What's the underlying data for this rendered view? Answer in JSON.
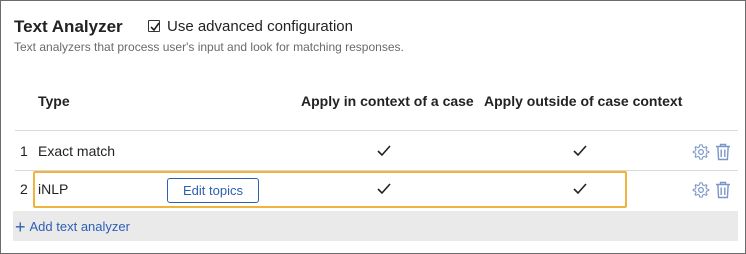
{
  "header": {
    "title": "Text Analyzer",
    "advanced_config_label": "Use advanced configuration",
    "advanced_config_checked": true,
    "subtitle": "Text analyzers that process user's input and look for matching responses."
  },
  "table": {
    "columns": [
      "Type",
      "Apply in context of a case",
      "Apply outside of case context"
    ],
    "rows": [
      {
        "index": "1",
        "type": "Exact match",
        "apply_in_case": true,
        "apply_outside_case": true
      },
      {
        "index": "2",
        "type": "iNLP",
        "apply_in_case": true,
        "apply_outside_case": true,
        "button": "Edit topics"
      }
    ]
  },
  "footer": {
    "add_label": "Add text analyzer"
  },
  "colors": {
    "accent": "#2d5fb4",
    "highlight": "#f0b43c",
    "footer_bg": "#eaeaea",
    "icon": "#7a96c8"
  }
}
